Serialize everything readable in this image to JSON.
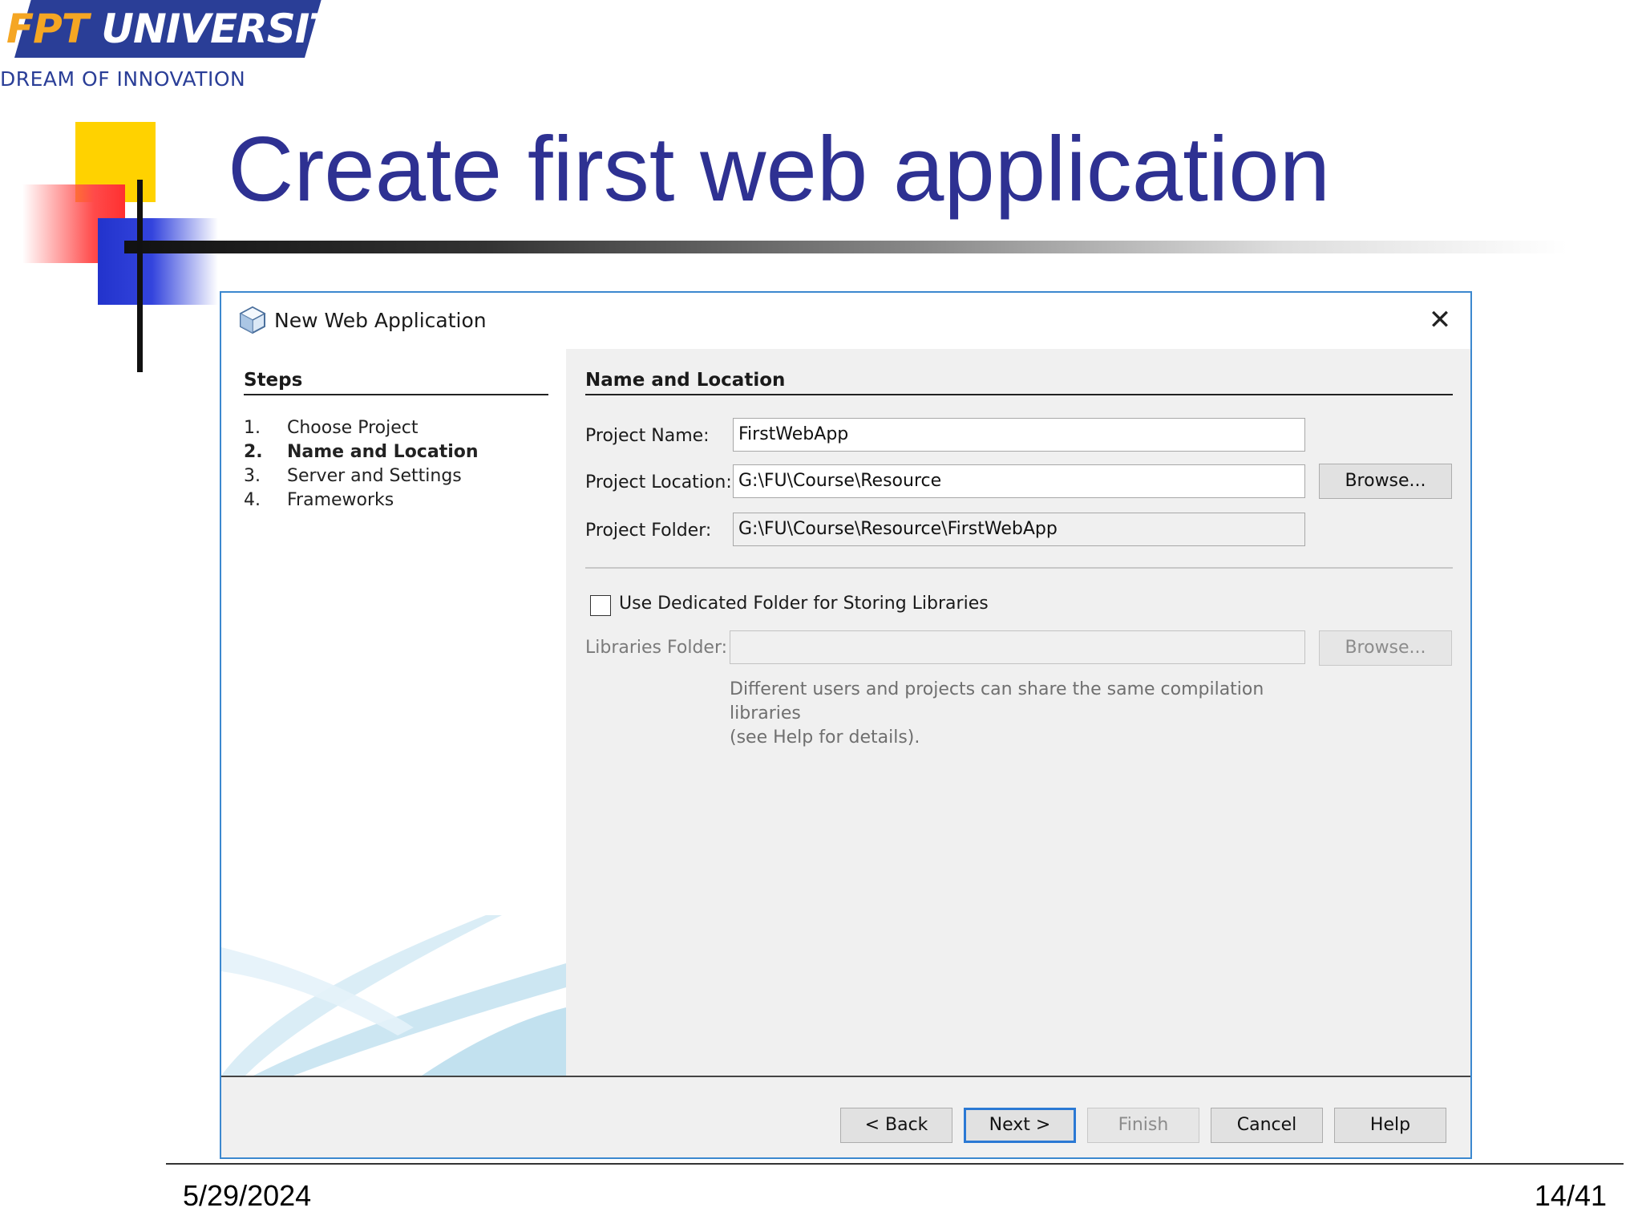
{
  "logo": {
    "fpt": "FPT",
    "university": "UNIVERSITY",
    "tagline": "DREAM OF INNOVATION"
  },
  "slide": {
    "title": "Create first web application",
    "date": "5/29/2024",
    "page": "14/41"
  },
  "dialog": {
    "title": "New Web Application",
    "close_symbol": "✕",
    "steps": {
      "heading": "Steps",
      "items": [
        {
          "num": "1.",
          "label": "Choose Project"
        },
        {
          "num": "2.",
          "label": "Name and Location"
        },
        {
          "num": "3.",
          "label": "Server and Settings"
        },
        {
          "num": "4.",
          "label": "Frameworks"
        }
      ],
      "current_index": 1
    },
    "section": {
      "heading": "Name and Location",
      "project_name_label": "Project Name:",
      "project_name_value": "FirstWebApp",
      "project_location_label": "Project Location:",
      "project_location_value": "G:\\FU\\Course\\Resource",
      "project_folder_label": "Project Folder:",
      "project_folder_value": "G:\\FU\\Course\\Resource\\FirstWebApp",
      "browse_label": "Browse...",
      "dedicated_folder_label": "Use Dedicated Folder for Storing Libraries",
      "dedicated_folder_checked": false,
      "libraries_folder_label": "Libraries Folder:",
      "libraries_folder_value": "",
      "libraries_browse_label": "Browse...",
      "hint_line1": "Different users and projects can share the same compilation libraries",
      "hint_line2": "(see Help for details)."
    },
    "buttons": {
      "back": "< Back",
      "next": "Next >",
      "finish": "Finish",
      "cancel": "Cancel",
      "help": "Help"
    }
  },
  "colors": {
    "title_blue": "#2e3192",
    "dialog_border": "#3c88cf",
    "default_button_border": "#2b79d4"
  },
  "icons": {
    "app": "netbeans-cube-icon",
    "close": "close-icon"
  }
}
